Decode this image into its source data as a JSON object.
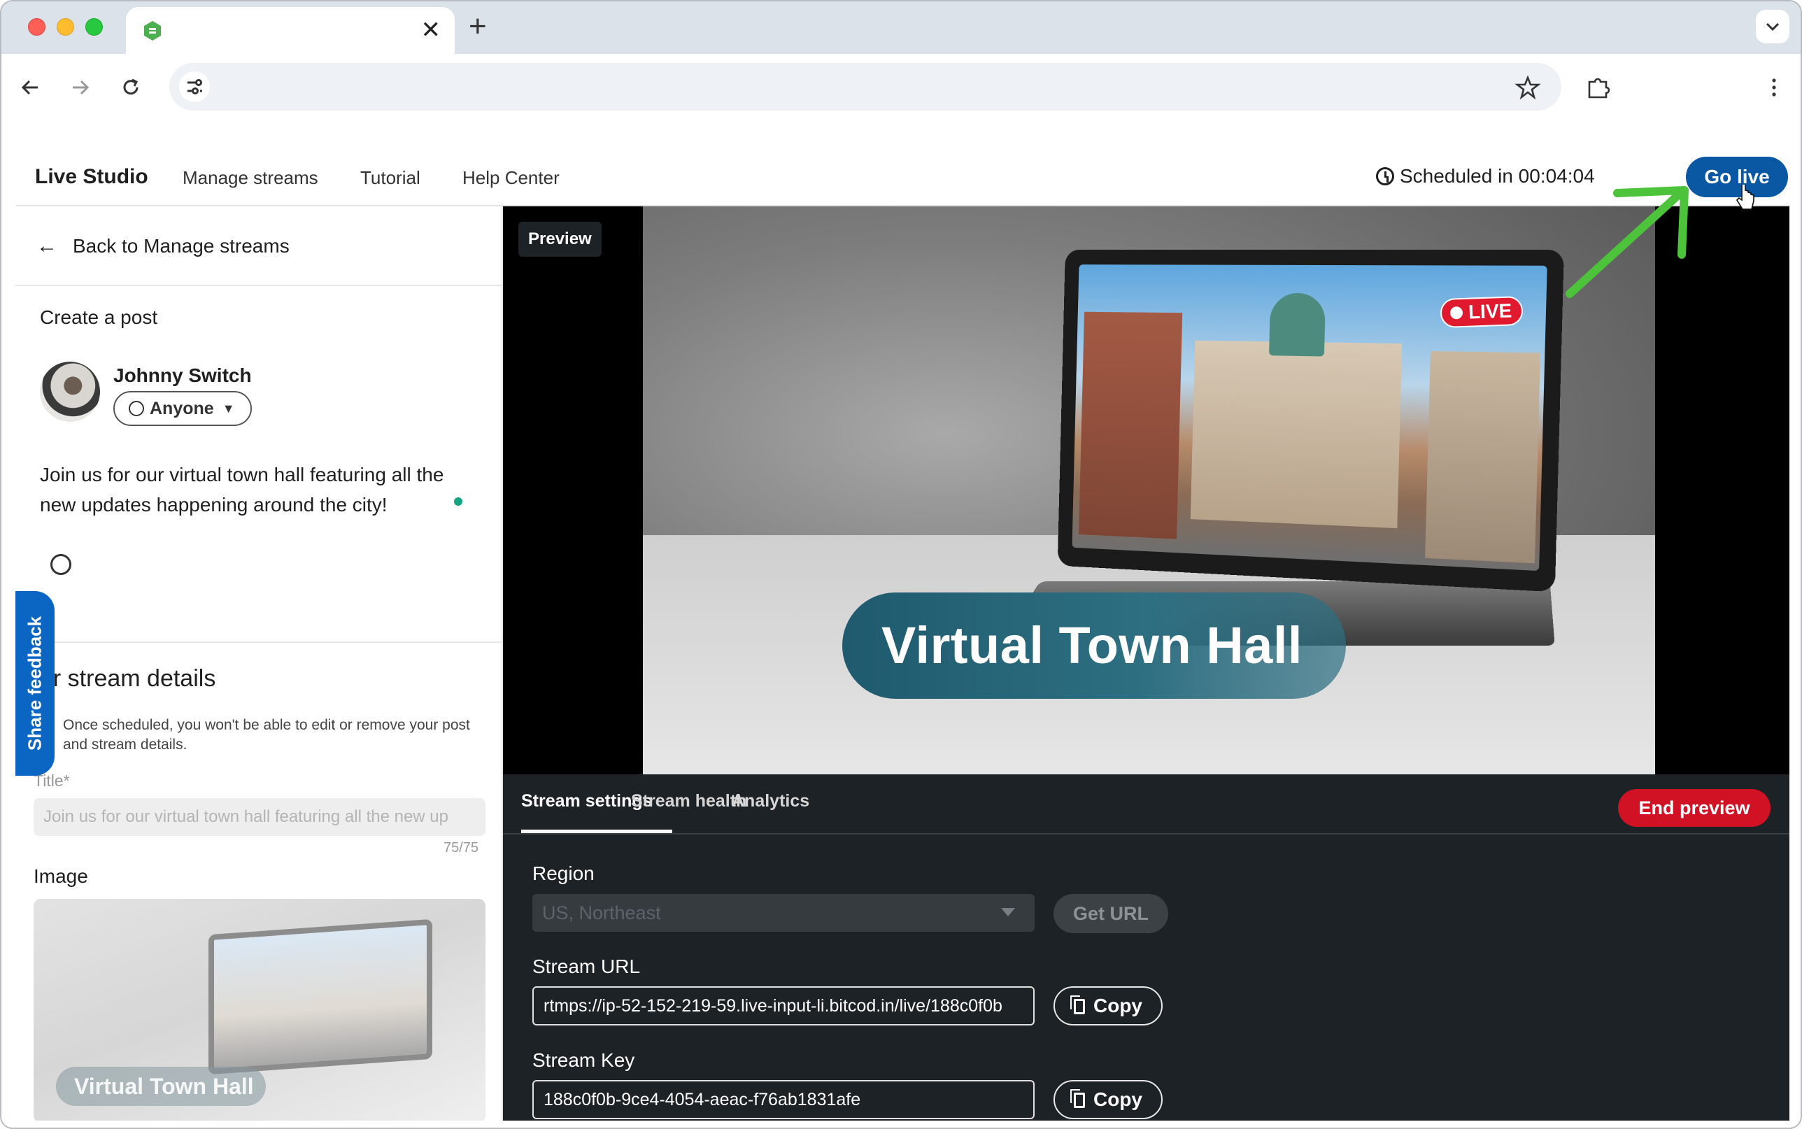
{
  "browser": {
    "tab_title": "",
    "tab_close": "✕",
    "new_tab": "+",
    "address": ""
  },
  "nav": {
    "brand": "Live Studio",
    "links": [
      "Manage streams",
      "Tutorial",
      "Help Center"
    ],
    "schedule": "Scheduled in 00:04:04",
    "go_live": "Go live"
  },
  "left": {
    "back": "Back to Manage streams",
    "create_post": "Create a post",
    "author": "Johnny Switch",
    "audience": "Anyone",
    "post_text": "Join us for our virtual town hall featuring all the new updates happening around the city!",
    "details_title": "ur stream details",
    "info_note": "Once scheduled, you won't be able to edit or remove your post and stream details.",
    "title_label": "Title*",
    "title_value": "Join us for our virtual town hall featuring all the new up",
    "counter": "75/75",
    "image_label": "Image",
    "image_caption": "Virtual Town Hall",
    "feedback": "Share feedback"
  },
  "preview": {
    "badge": "Preview",
    "live_badge": "LIVE",
    "banner": "Virtual Town Hall"
  },
  "tabs": {
    "items": [
      "Stream settings",
      "Stream health",
      "Analytics"
    ],
    "active": "Stream settings",
    "end_preview": "End preview"
  },
  "settings": {
    "region_label": "Region",
    "region_value": "US, Northeast",
    "get_url": "Get URL",
    "stream_url_label": "Stream URL",
    "stream_url": "rtmps://ip-52-152-219-59.live-input-li.bitcod.in/live/188c0f0b",
    "stream_key_label": "Stream Key",
    "stream_key": "188c0f0b-9ce4-4054-aeac-f76ab1831afe",
    "copy": "Copy"
  },
  "colors": {
    "accent": "#0a57a4",
    "danger": "#d11124",
    "annotation_arrow": "#4cc33a",
    "panel_dark": "#1d2226"
  }
}
